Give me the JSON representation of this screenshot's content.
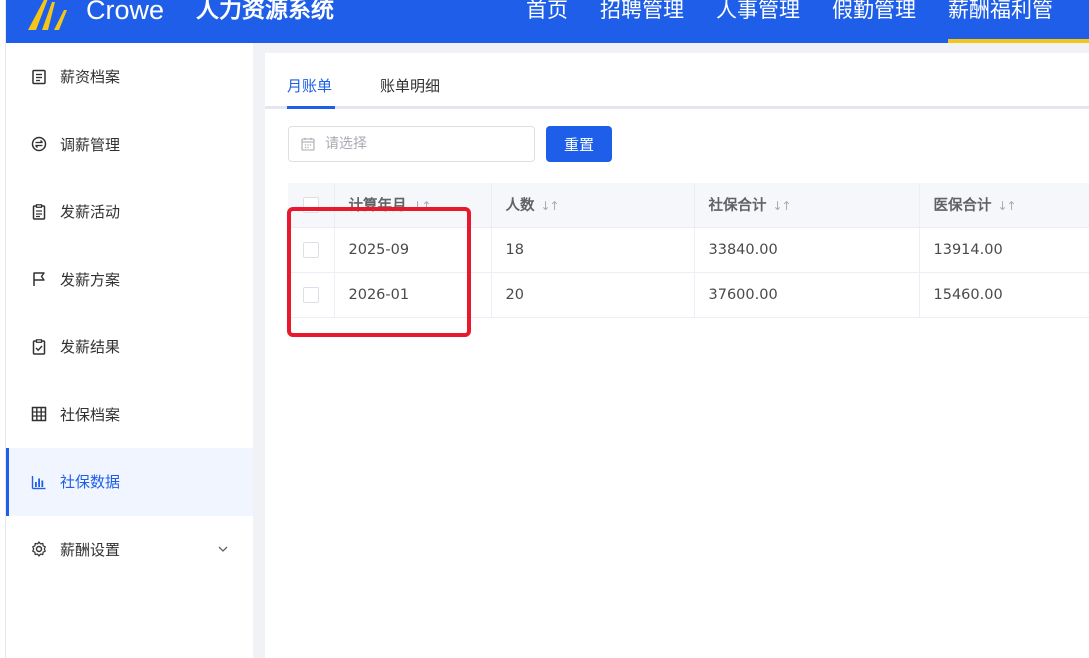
{
  "header": {
    "brand": "Crowe",
    "system_title": "人力资源系统",
    "nav": [
      "首页",
      "招聘管理",
      "人事管理",
      "假勤管理",
      "薪酬福利管"
    ],
    "active_nav_index": 4,
    "accent_color": "#1e5ee8",
    "active_underline_color": "#f5c518"
  },
  "sidebar": {
    "items": [
      {
        "label": "薪资档案",
        "icon": "document-icon"
      },
      {
        "label": "调薪管理",
        "icon": "exchange-icon"
      },
      {
        "label": "发薪活动",
        "icon": "clipboard-list-icon"
      },
      {
        "label": "发薪方案",
        "icon": "flag-icon"
      },
      {
        "label": "发薪结果",
        "icon": "clipboard-check-icon"
      },
      {
        "label": "社保档案",
        "icon": "grid-icon"
      },
      {
        "label": "社保数据",
        "icon": "bar-chart-icon"
      },
      {
        "label": "薪酬设置",
        "icon": "gear-icon"
      }
    ],
    "active_index": 6
  },
  "tabs": [
    {
      "label": "月账单"
    },
    {
      "label": "账单明细"
    }
  ],
  "active_tab_index": 0,
  "filter": {
    "date_placeholder": "请选择",
    "reset_label": "重置"
  },
  "table": {
    "columns": [
      "计算年月",
      "人数",
      "社保合计",
      "医保合计"
    ],
    "rows": [
      [
        "2025-09",
        "18",
        "33840.00",
        "13914.00"
      ],
      [
        "2026-01",
        "20",
        "37600.00",
        "15460.00"
      ]
    ]
  },
  "annotation_color": "#e8192c"
}
